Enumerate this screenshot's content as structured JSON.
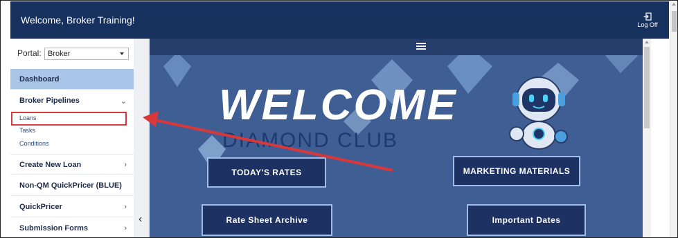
{
  "header": {
    "welcome_text": "Welcome, Broker Training!",
    "logoff_label": "Log Off"
  },
  "sidebar": {
    "portal_label": "Portal:",
    "portal_value": "Broker",
    "items": [
      {
        "label": "Dashboard"
      },
      {
        "label": "Broker Pipelines"
      },
      {
        "label": "Create New Loan"
      },
      {
        "label": "Non-QM QuickPricer (BLUE)"
      },
      {
        "label": "QuickPricer"
      },
      {
        "label": "Submission Forms"
      }
    ],
    "sub_items": [
      {
        "label": "Loans"
      },
      {
        "label": "Tasks"
      },
      {
        "label": "Conditions"
      }
    ]
  },
  "banner": {
    "welcome": "WELCOME",
    "subtitle": "DIAMOND CLUB"
  },
  "buttons": {
    "todays_rates": "TODAY'S RATES",
    "marketing_materials": "MARKETING MATERIALS",
    "rate_sheet_archive": "Rate Sheet Archive",
    "important_dates": "Important Dates"
  },
  "colors": {
    "header": "#17315e",
    "active_nav": "#a9c6e8",
    "highlight_box": "#d9383a",
    "main_bg": "#3f5f94"
  }
}
